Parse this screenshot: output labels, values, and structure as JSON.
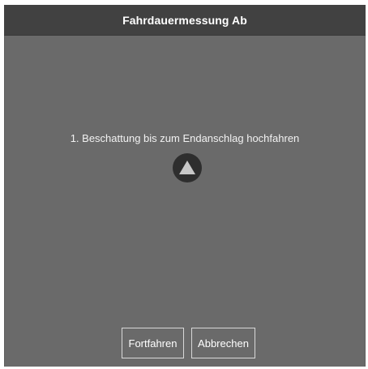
{
  "dialog": {
    "title": "Fahrdauermessung Ab",
    "instruction": "1. Beschattung bis zum Endanschlag hochfahren",
    "up_button_icon": "triangle-up-icon",
    "continue_label": "Fortfahren",
    "cancel_label": "Abbrechen"
  },
  "colors": {
    "background": "#6a6a6a",
    "titlebar": "#414141",
    "button_circle": "#2e2e2e",
    "triangle": "#c8c8c8",
    "button_border": "#d8d8d8",
    "text": "#ffffff"
  }
}
